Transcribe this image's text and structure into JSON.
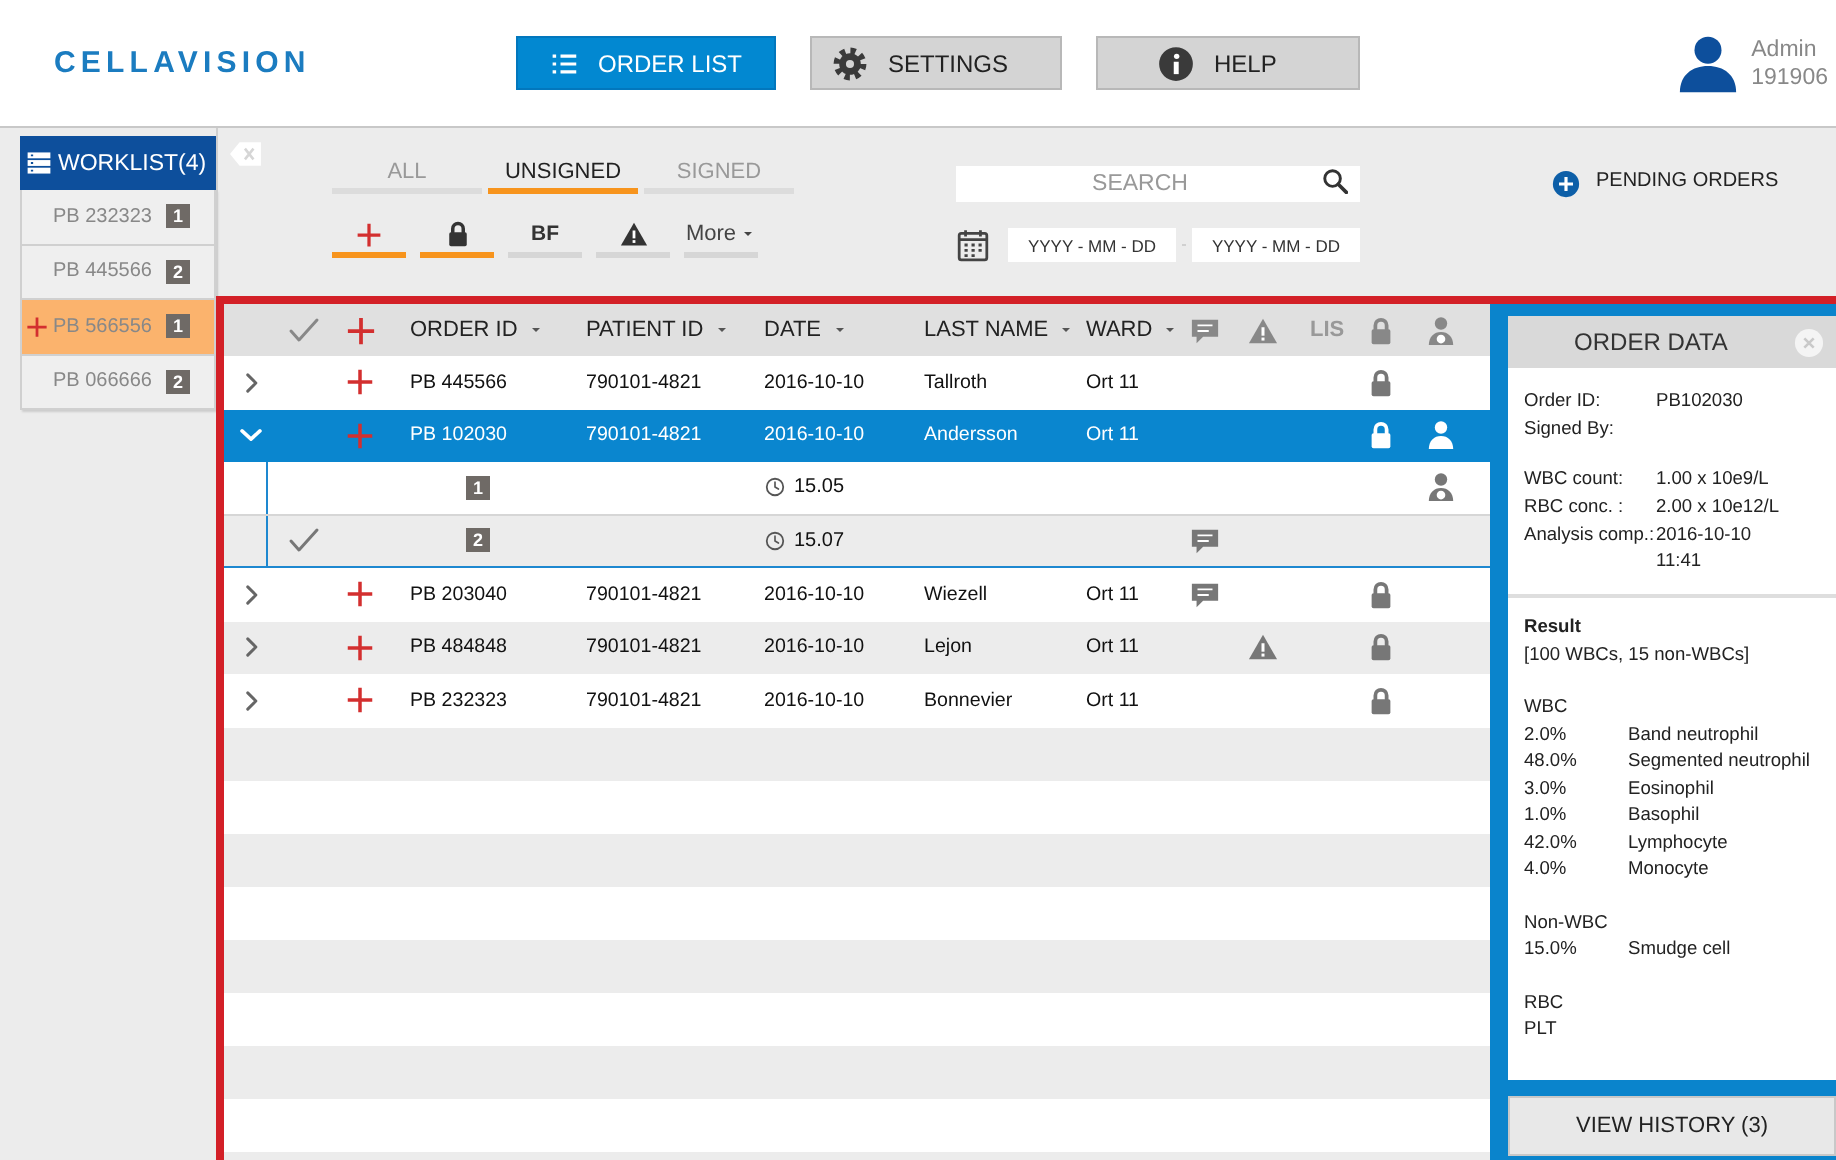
{
  "header": {
    "logo": "CELLAVISION",
    "nav": [
      {
        "label": "ORDER LIST",
        "selected": true
      },
      {
        "label": "SETTINGS",
        "selected": false
      },
      {
        "label": "HELP",
        "selected": false
      }
    ],
    "user": {
      "name": "Admin",
      "id": "191906"
    }
  },
  "worklist": {
    "title": "WORKLIST(4)",
    "items": [
      {
        "order_id": "PB 232323",
        "count": "1",
        "selected": false,
        "new": false
      },
      {
        "order_id": "PB 445566",
        "count": "2",
        "selected": false,
        "new": false
      },
      {
        "order_id": "PB 566556",
        "count": "1",
        "selected": true,
        "new": true
      },
      {
        "order_id": "PB 066666",
        "count": "2",
        "selected": false,
        "new": false
      }
    ]
  },
  "filters": {
    "tabs": [
      {
        "label": "ALL",
        "selected": false
      },
      {
        "label": "UNSIGNED",
        "selected": true
      },
      {
        "label": "SIGNED",
        "selected": false
      }
    ],
    "buttons": [
      {
        "kind": "plus",
        "selected": true
      },
      {
        "kind": "lock",
        "selected": true
      },
      {
        "kind": "text",
        "label": "BF",
        "selected": false
      },
      {
        "kind": "warning",
        "selected": false
      },
      {
        "kind": "menu",
        "label": "More",
        "selected": false
      }
    ],
    "search": {
      "placeholder": "SEARCH"
    },
    "date_from": {
      "placeholder": "YYYY - MM - DD"
    },
    "date_to": {
      "placeholder": "YYYY - MM - DD"
    }
  },
  "pending_orders": {
    "label": "PENDING ORDERS"
  },
  "table": {
    "columns": [
      {
        "kind": "check"
      },
      {
        "kind": "plus"
      },
      {
        "kind": "sort",
        "label": "ORDER ID"
      },
      {
        "kind": "sort",
        "label": "PATIENT ID"
      },
      {
        "kind": "sort",
        "label": "DATE"
      },
      {
        "kind": "sort",
        "label": "LAST NAME"
      },
      {
        "kind": "sort",
        "label": "WARD"
      },
      {
        "kind": "comment"
      },
      {
        "kind": "warning"
      },
      {
        "kind": "label",
        "label": "LIS"
      },
      {
        "kind": "lock"
      },
      {
        "kind": "person"
      }
    ],
    "rows": [
      {
        "kind": "order",
        "expanded": false,
        "selected": false,
        "new": true,
        "order_id": "PB 445566",
        "patient_id": "790101-4821",
        "date": "2016-10-10",
        "last_name": "Tallroth",
        "ward": "Ort 11",
        "comment": false,
        "warning": false,
        "locked": true,
        "assigned": false
      },
      {
        "kind": "order",
        "expanded": true,
        "selected": true,
        "new": true,
        "order_id": "PB 102030",
        "patient_id": "790101-4821",
        "date": "2016-10-10",
        "last_name": "Andersson",
        "ward": "Ort 11",
        "comment": false,
        "warning": false,
        "locked": true,
        "assigned": true
      },
      {
        "kind": "sample",
        "index": "1",
        "time": "15.05",
        "signed": false,
        "comment": false,
        "assigned": true
      },
      {
        "kind": "sample",
        "index": "2",
        "time": "15.07",
        "signed": true,
        "comment": true,
        "assigned": false
      },
      {
        "kind": "order",
        "expanded": false,
        "selected": false,
        "new": true,
        "order_id": "PB 203040",
        "patient_id": "790101-4821",
        "date": "2016-10-10",
        "last_name": "Wiezell",
        "ward": "Ort 11",
        "comment": true,
        "warning": false,
        "locked": true,
        "assigned": false
      },
      {
        "kind": "order",
        "expanded": false,
        "selected": false,
        "new": true,
        "order_id": "PB 484848",
        "patient_id": "790101-4821",
        "date": "2016-10-10",
        "last_name": "Lejon",
        "ward": "Ort 11",
        "comment": false,
        "warning": true,
        "locked": true,
        "assigned": false
      },
      {
        "kind": "order",
        "expanded": false,
        "selected": false,
        "new": true,
        "order_id": "PB 232323",
        "patient_id": "790101-4821",
        "date": "2016-10-10",
        "last_name": "Bonnevier",
        "ward": "Ort 11",
        "comment": false,
        "warning": false,
        "locked": true,
        "assigned": false
      }
    ]
  },
  "order_data": {
    "title": "ORDER DATA",
    "fields": [
      {
        "label": "Order ID:",
        "lines": [
          "PB102030"
        ]
      },
      {
        "label": "Signed By:"
      }
    ],
    "measurements": [
      {
        "label": "WBC count:",
        "lines": [
          "1.00 x 10e9/L"
        ]
      },
      {
        "label": "RBC conc. :",
        "lines": [
          "2.00 x 10e12/L"
        ]
      },
      {
        "label": "Analysis comp.:",
        "lines": [
          "2016-10-10",
          "11:41"
        ]
      }
    ],
    "result": {
      "title": "Result",
      "summary": "[100 WBCs, 15 non-WBCs]",
      "groups": [
        {
          "name": "WBC",
          "items": [
            {
              "percent": "2.0%",
              "cell": "Band neutrophil"
            },
            {
              "percent": "48.0%",
              "cell": "Segmented neutrophil"
            },
            {
              "percent": "3.0%",
              "cell": "Eosinophil"
            },
            {
              "percent": "1.0%",
              "cell": "Basophil"
            },
            {
              "percent": "42.0%",
              "cell": "Lymphocyte"
            },
            {
              "percent": "4.0%",
              "cell": "Monocyte"
            }
          ]
        },
        {
          "name": "Non-WBC",
          "items": [
            {
              "percent": "15.0%",
              "cell": "Smudge cell"
            }
          ]
        },
        {
          "name": "RBC"
        },
        {
          "name": "PLT"
        }
      ]
    },
    "history_button": "VIEW HISTORY (3)"
  }
}
